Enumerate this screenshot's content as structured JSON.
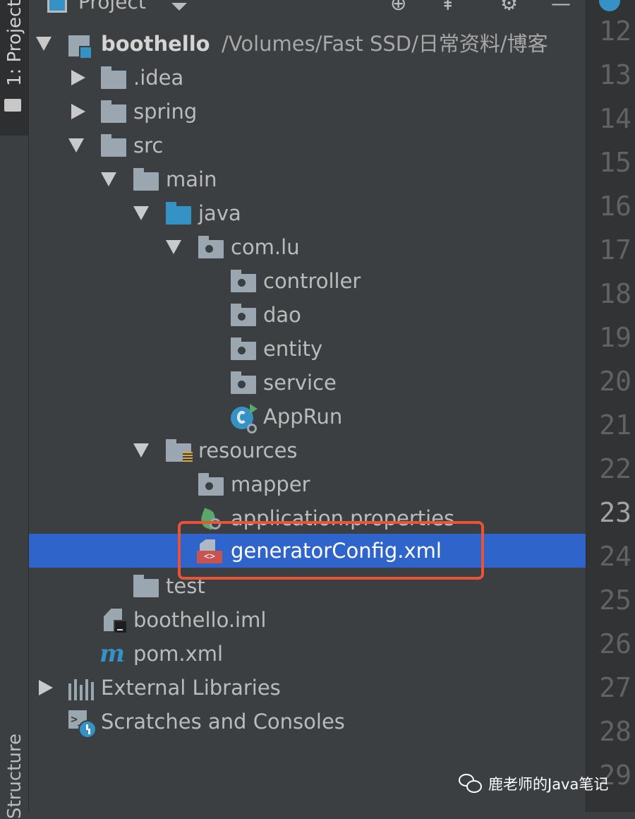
{
  "toolstrip": {
    "project_tab": "1: Project",
    "structure_tab": "Structure"
  },
  "header": {
    "title": "Project"
  },
  "tree": {
    "root": {
      "name": "boothello",
      "path": "/Volumes/Fast SSD/日常资料/博客"
    },
    "items": [
      {
        "label": ".idea"
      },
      {
        "label": "spring"
      },
      {
        "label": "src"
      },
      {
        "label": "main"
      },
      {
        "label": "java"
      },
      {
        "label": "com.lu"
      },
      {
        "label": "controller"
      },
      {
        "label": "dao"
      },
      {
        "label": "entity"
      },
      {
        "label": "service"
      },
      {
        "label": "AppRun"
      },
      {
        "label": "resources"
      },
      {
        "label": "mapper"
      },
      {
        "label": "application.properties"
      },
      {
        "label": "generatorConfig.xml",
        "selected": true
      },
      {
        "label": "test"
      },
      {
        "label": "boothello.iml"
      },
      {
        "label": "pom.xml"
      },
      {
        "label": "External Libraries"
      },
      {
        "label": "Scratches and Consoles"
      }
    ]
  },
  "gutter": {
    "line_numbers": [
      "12",
      "13",
      "14",
      "15",
      "16",
      "17",
      "18",
      "19",
      "20",
      "21",
      "22",
      "23",
      "24",
      "25",
      "26",
      "27",
      "28",
      "29"
    ],
    "current_line": "23"
  },
  "watermark": {
    "text": "鹿老师的Java笔记"
  },
  "colors": {
    "selection": "#2f65ca",
    "highlight_box": "#e8543a",
    "panel_bg": "#3c3f41",
    "gutter_bg": "#313335"
  }
}
